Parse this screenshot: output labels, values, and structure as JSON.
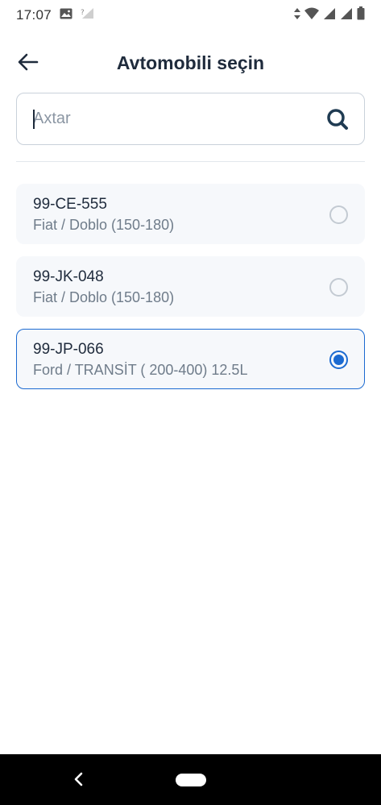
{
  "status_bar": {
    "time": "17:07"
  },
  "header": {
    "title": "Avtomobili seçin"
  },
  "search": {
    "placeholder": "Axtar",
    "value": ""
  },
  "vehicles": [
    {
      "plate": "99-CE-555",
      "model": "Fiat / Doblo (150-180)",
      "selected": false
    },
    {
      "plate": "99-JK-048",
      "model": "Fiat / Doblo (150-180)",
      "selected": false
    },
    {
      "plate": "99-JP-066",
      "model": "Ford / TRANSİT ( 200-400) 12.5L",
      "selected": true
    }
  ],
  "colors": {
    "accent": "#1b6ad1",
    "card_bg": "#f6f8fb",
    "title_text": "#1f2b3c",
    "secondary_text": "#6f7c8a"
  },
  "icons": {
    "back": "arrow-left-icon",
    "search": "magnifier-icon",
    "gallery": "image-icon",
    "signal": "signal-icon",
    "wifi": "wifi-icon",
    "battery": "battery-icon"
  }
}
